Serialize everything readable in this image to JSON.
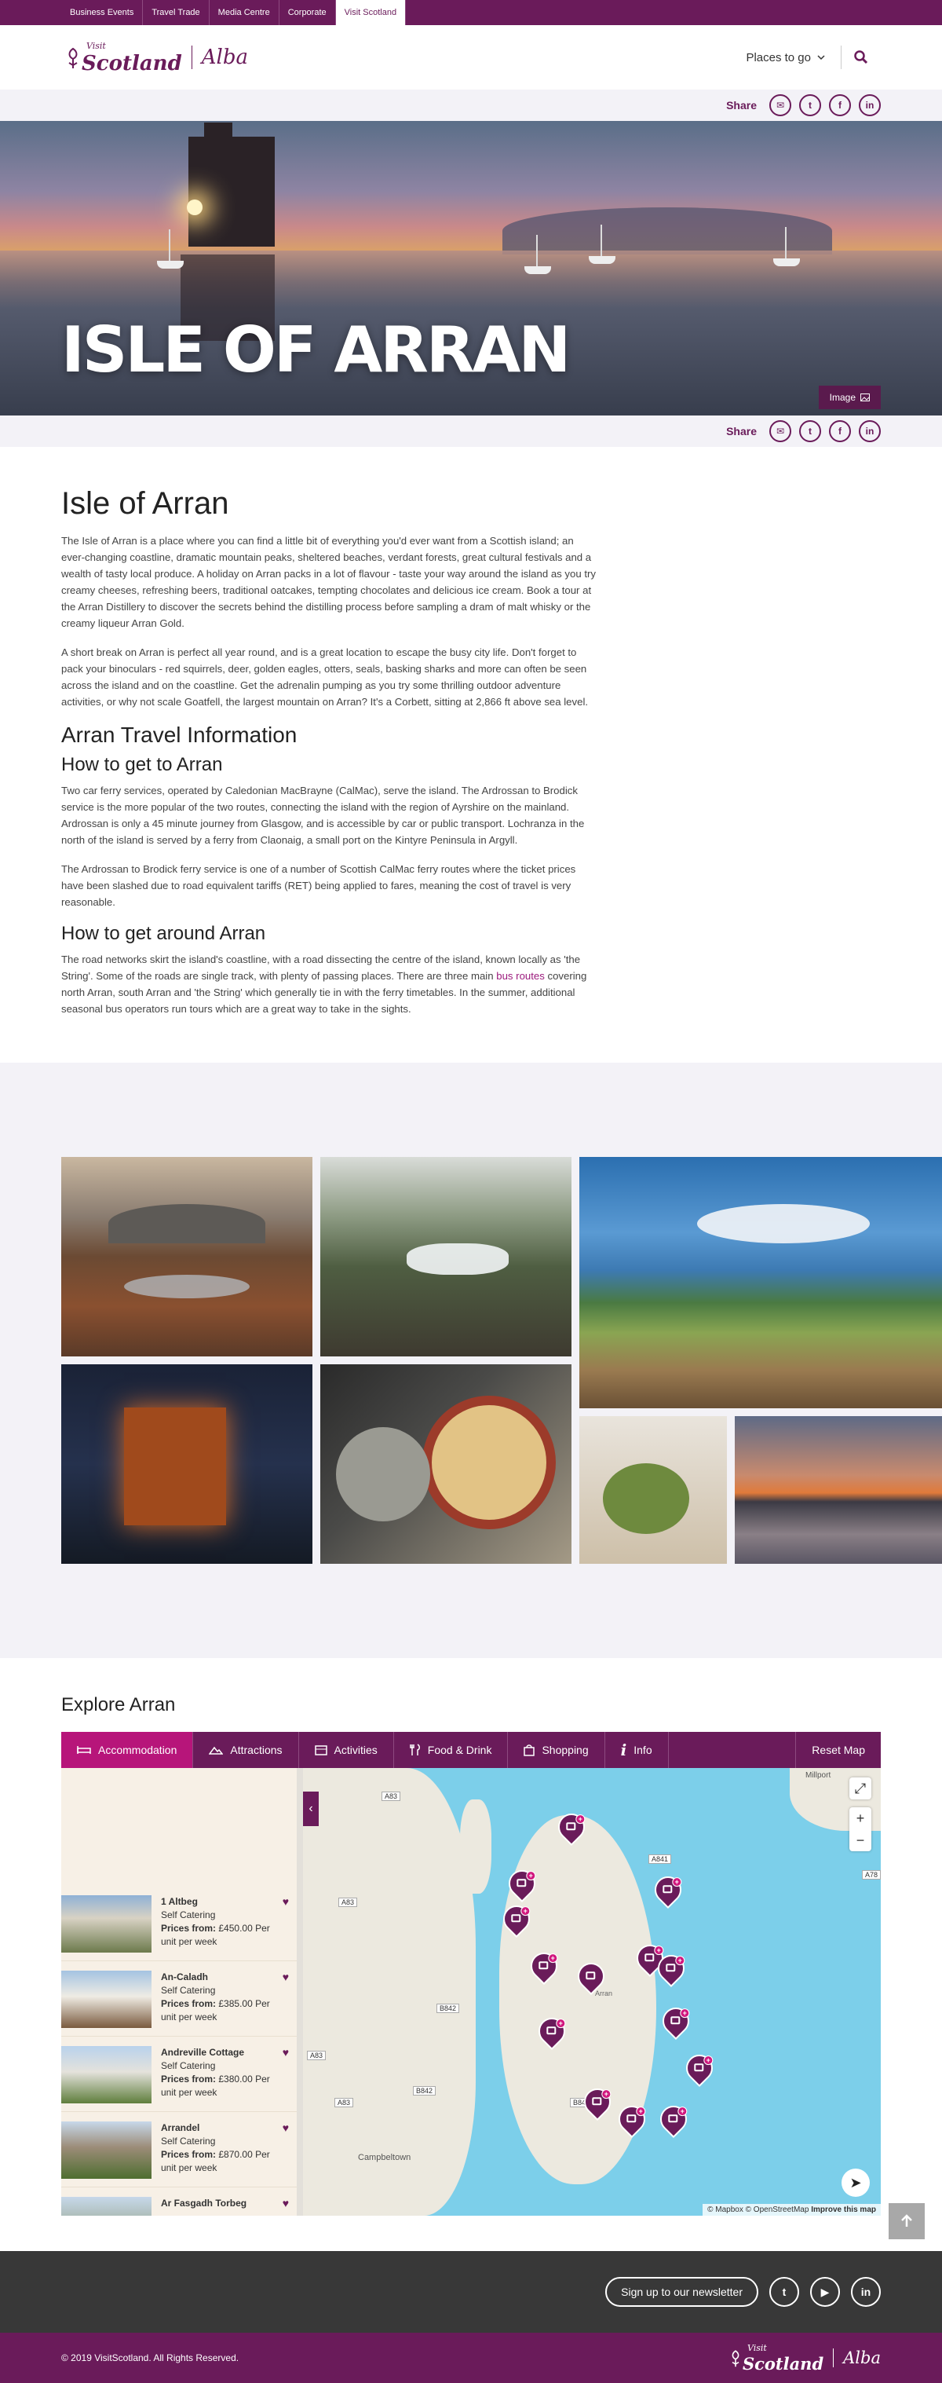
{
  "topbar": {
    "links": [
      "Business Events",
      "Travel Trade",
      "Media Centre",
      "Corporate",
      "Visit Scotland"
    ]
  },
  "header": {
    "logo_visit": "Visit",
    "logo_scotland": "Scotland",
    "logo_alba": "Alba",
    "places_label": "Places to go"
  },
  "share": {
    "label": "Share"
  },
  "hero": {
    "title": "ISLE OF ARRAN",
    "image_button": "Image"
  },
  "article": {
    "title": "Isle of Arran",
    "intro_p1": "The Isle of Arran is a place where you can find a little bit of everything you'd ever want from a Scottish island; an ever-changing coastline, dramatic mountain peaks, sheltered beaches, verdant forests, great cultural festivals and a wealth of tasty local produce. A holiday on Arran packs in a lot of flavour - taste your way around the island as you try creamy cheeses, refreshing beers, traditional oatcakes, tempting chocolates and delicious ice cream. Book a tour at the Arran Distillery to discover the secrets behind the distilling process before sampling a dram of malt whisky or the creamy liqueur Arran Gold.",
    "intro_p2": "A short break on Arran is perfect all year round, and is a great location to escape the busy city life. Don't forget to pack your binoculars - red squirrels, deer, golden eagles, otters, seals, basking sharks and more can often be seen across the island and on the coastline. Get the adrenalin pumping as you try some thrilling outdoor adventure activities, or why not scale Goatfell, the largest mountain on Arran? It's a Corbett, sitting at 2,866 ft above sea level.",
    "travel_heading": "Arran Travel Information",
    "get_to_heading": "How to get to Arran",
    "get_to_p1": "Two car ferry services, operated by Caledonian MacBrayne (CalMac), serve the island. The Ardrossan to Brodick service is the more popular of the two routes, connecting the island with the region of Ayrshire on the mainland. Ardrossan is only a 45 minute journey from Glasgow, and is accessible by car or public transport. Lochranza in the north of the island is served by a ferry from Claonaig, a small port on the Kintyre Peninsula in Argyll.",
    "get_to_p2": "The Ardrossan to Brodick ferry service is one of a number of Scottish CalMac ferry routes where the ticket prices have been slashed due to road equivalent tariffs (RET) being applied to fares, meaning the cost of travel is very reasonable.",
    "around_heading": "How to get around Arran",
    "around_p_before": "The road networks skirt the island's coastline, with a road dissecting the centre of the island, known locally as 'the String'. Some of the roads are single track, with plenty of passing places. There are three main ",
    "around_link": "bus routes",
    "around_p_after": " covering north Arran, south Arran and 'the String' which generally tie in with the ferry timetables. In the summer, additional seasonal bus operators run tours which are a great way to take in the sights."
  },
  "explore": {
    "title": "Explore Arran",
    "tabs": [
      "Accommodation",
      "Attractions",
      "Activities",
      "Food & Drink",
      "Shopping",
      "Info"
    ],
    "reset": "Reset Map",
    "listings": [
      {
        "name": "1 Altbeg",
        "type": "Self Catering",
        "price_label": "Prices from:",
        "price": "£450.00 Per unit per week"
      },
      {
        "name": "An-Caladh",
        "type": "Self Catering",
        "price_label": "Prices from:",
        "price": "£385.00 Per unit per week"
      },
      {
        "name": "Andreville Cottage",
        "type": "Self Catering",
        "price_label": "Prices from:",
        "price": "£380.00 Per unit per week"
      },
      {
        "name": "Arrandel",
        "type": "Self Catering",
        "price_label": "Prices from:",
        "price": "£870.00 Per unit per week"
      },
      {
        "name": "Ar Fasgadh Torbeg",
        "type": "",
        "price_label": "",
        "price": ""
      }
    ],
    "map": {
      "places": [
        "Millport",
        "Campbeltown",
        "Arran"
      ],
      "roads": [
        "A83",
        "A83",
        "A83",
        "A83",
        "A841",
        "A78",
        "B842",
        "B842",
        "B842"
      ],
      "attribution_mapbox": "© Mapbox",
      "attribution_osm": "© OpenStreetMap",
      "attribution_improve": "Improve this map",
      "zoom_in": "+",
      "zoom_out": "−"
    }
  },
  "footer": {
    "newsletter": "Sign up to our newsletter",
    "copyright": "© 2019 VisitScotland. All Rights Reserved."
  },
  "colors": {
    "brand": "#6a1b5a",
    "accent": "#b7157a",
    "link": "#9c1b7d"
  }
}
